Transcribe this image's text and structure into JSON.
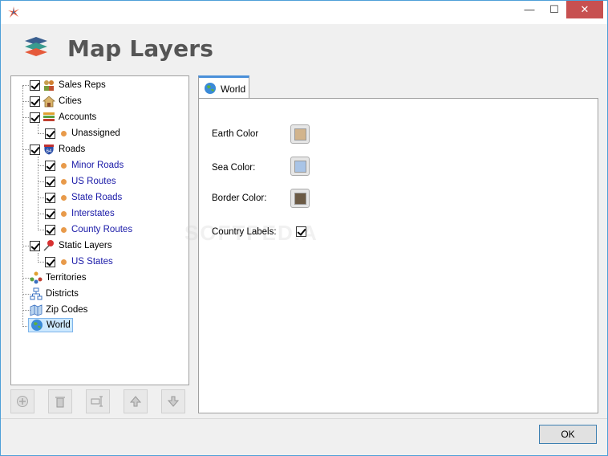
{
  "window": {
    "title": "",
    "minimize_glyph": "—",
    "maximize_glyph": "☐",
    "close_glyph": "✕"
  },
  "header": {
    "title": "Map Layers",
    "icon": "layers-icon"
  },
  "tree": {
    "items": [
      {
        "label": "Sales Reps",
        "checked": true,
        "icon": "sales-reps-icon",
        "level": 1
      },
      {
        "label": "Cities",
        "checked": true,
        "icon": "house-icon",
        "level": 1
      },
      {
        "label": "Accounts",
        "checked": true,
        "icon": "accounts-icon",
        "level": 1
      },
      {
        "label": "Unassigned",
        "checked": true,
        "icon": "orange-dot",
        "level": 2
      },
      {
        "label": "Roads",
        "checked": true,
        "icon": "interstate-shield-icon",
        "level": 1
      },
      {
        "label": "Minor Roads",
        "checked": true,
        "icon": "orange-dot",
        "level": 2
      },
      {
        "label": "US Routes",
        "checked": true,
        "icon": "orange-dot",
        "level": 2
      },
      {
        "label": "State Roads",
        "checked": true,
        "icon": "orange-dot",
        "level": 2
      },
      {
        "label": "Interstates",
        "checked": true,
        "icon": "orange-dot",
        "level": 2
      },
      {
        "label": "County Routes",
        "checked": true,
        "icon": "orange-dot",
        "level": 2
      },
      {
        "label": "Static Layers",
        "checked": true,
        "icon": "pushpin-icon",
        "level": 1
      },
      {
        "label": "US States",
        "checked": true,
        "icon": "orange-dot",
        "level": 2
      },
      {
        "label": "Territories",
        "icon": "territories-icon",
        "level": 1
      },
      {
        "label": "Districts",
        "icon": "districts-icon",
        "level": 1
      },
      {
        "label": "Zip Codes",
        "icon": "zip-codes-icon",
        "level": 1
      },
      {
        "label": "World",
        "icon": "globe-icon",
        "level": 1,
        "selected": true
      }
    ]
  },
  "toolbar": [
    "add-icon",
    "delete-icon",
    "properties-icon",
    "move-up-icon",
    "move-down-icon"
  ],
  "tab": {
    "label": "World",
    "icon": "globe-icon"
  },
  "form": {
    "earth_color_label": "Earth Color",
    "earth_color": "#d2b48c",
    "sea_color_label": "Sea Color:",
    "sea_color": "#a9c4e6",
    "border_color_label": "Border Color:",
    "border_color": "#6b5a45",
    "country_labels_label": "Country Labels:",
    "country_labels_checked": true
  },
  "watermark": "SOFTPEDIA",
  "footer": {
    "ok_label": "OK"
  },
  "colors": {
    "link_blue": "#1a1aa8",
    "dot_orange": "#e89a4a",
    "tab_accent": "#4a90d9",
    "window_border": "#4ea0d8"
  }
}
